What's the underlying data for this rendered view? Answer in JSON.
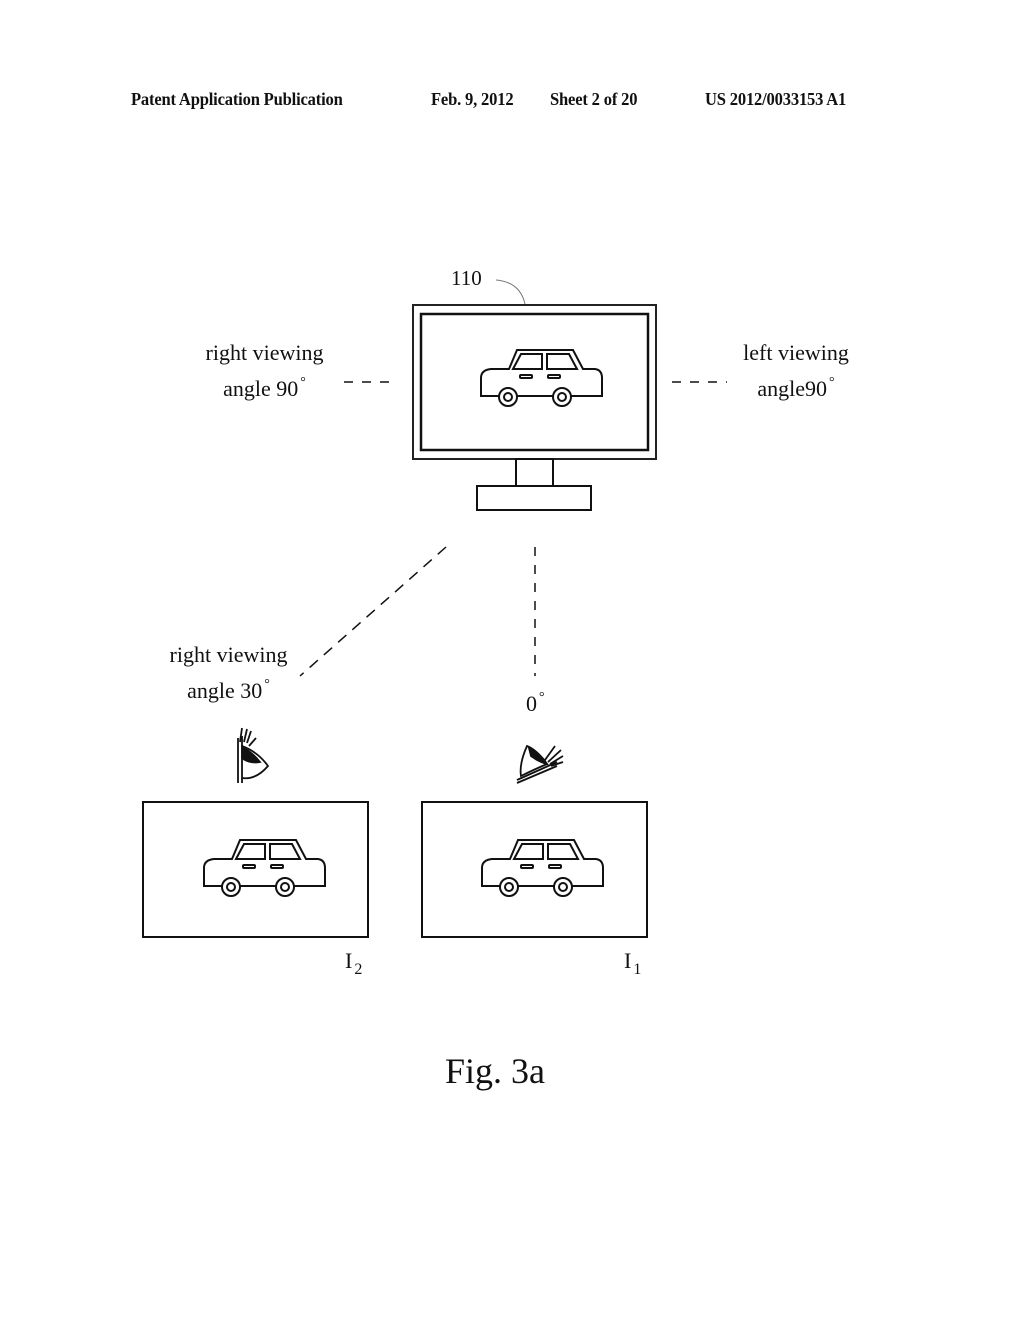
{
  "header": {
    "publication": "Patent Application Publication",
    "date": "Feb. 9, 2012",
    "sheet": "Sheet 2 of 20",
    "number": "US 2012/0033153 A1"
  },
  "figure": {
    "caption": "Fig. 3a",
    "display_ref": "110",
    "labels": {
      "right_90_line1": "right viewing",
      "right_90_line2": "angle 90",
      "left_90_line1": "left viewing",
      "left_90_line2": "angle90",
      "right_30_line1": "right viewing",
      "right_30_line2": "angle 30",
      "zero": "0",
      "degree_symbol": "°"
    },
    "images": [
      {
        "name": "I",
        "subscript": "2"
      },
      {
        "name": "I",
        "subscript": "1"
      }
    ],
    "icons": [
      "monitor-icon",
      "car-icon",
      "eye-icon"
    ]
  }
}
